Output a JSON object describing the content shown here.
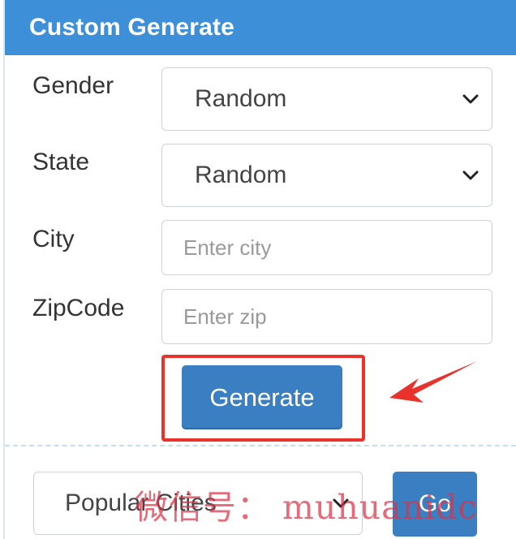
{
  "panel": {
    "title": "Custom Generate"
  },
  "form": {
    "gender": {
      "label": "Gender",
      "selected": "Random"
    },
    "state": {
      "label": "State",
      "selected": "Random"
    },
    "city": {
      "label": "City",
      "placeholder": "Enter city",
      "value": ""
    },
    "zipcode": {
      "label": "ZipCode",
      "placeholder": "Enter zip",
      "value": ""
    },
    "generate_label": "Generate"
  },
  "popular": {
    "selected": "Popular Cities",
    "go_label": "Go"
  },
  "watermark": "微信号： muhuanidc",
  "colors": {
    "header": "#3d90d8",
    "button": "#3a7fc1",
    "highlight": "#e8322b",
    "arrow": "#e8322b"
  },
  "icons": {
    "select_caret": "chevron-down-icon",
    "annotation": "red-arrow-icon"
  }
}
